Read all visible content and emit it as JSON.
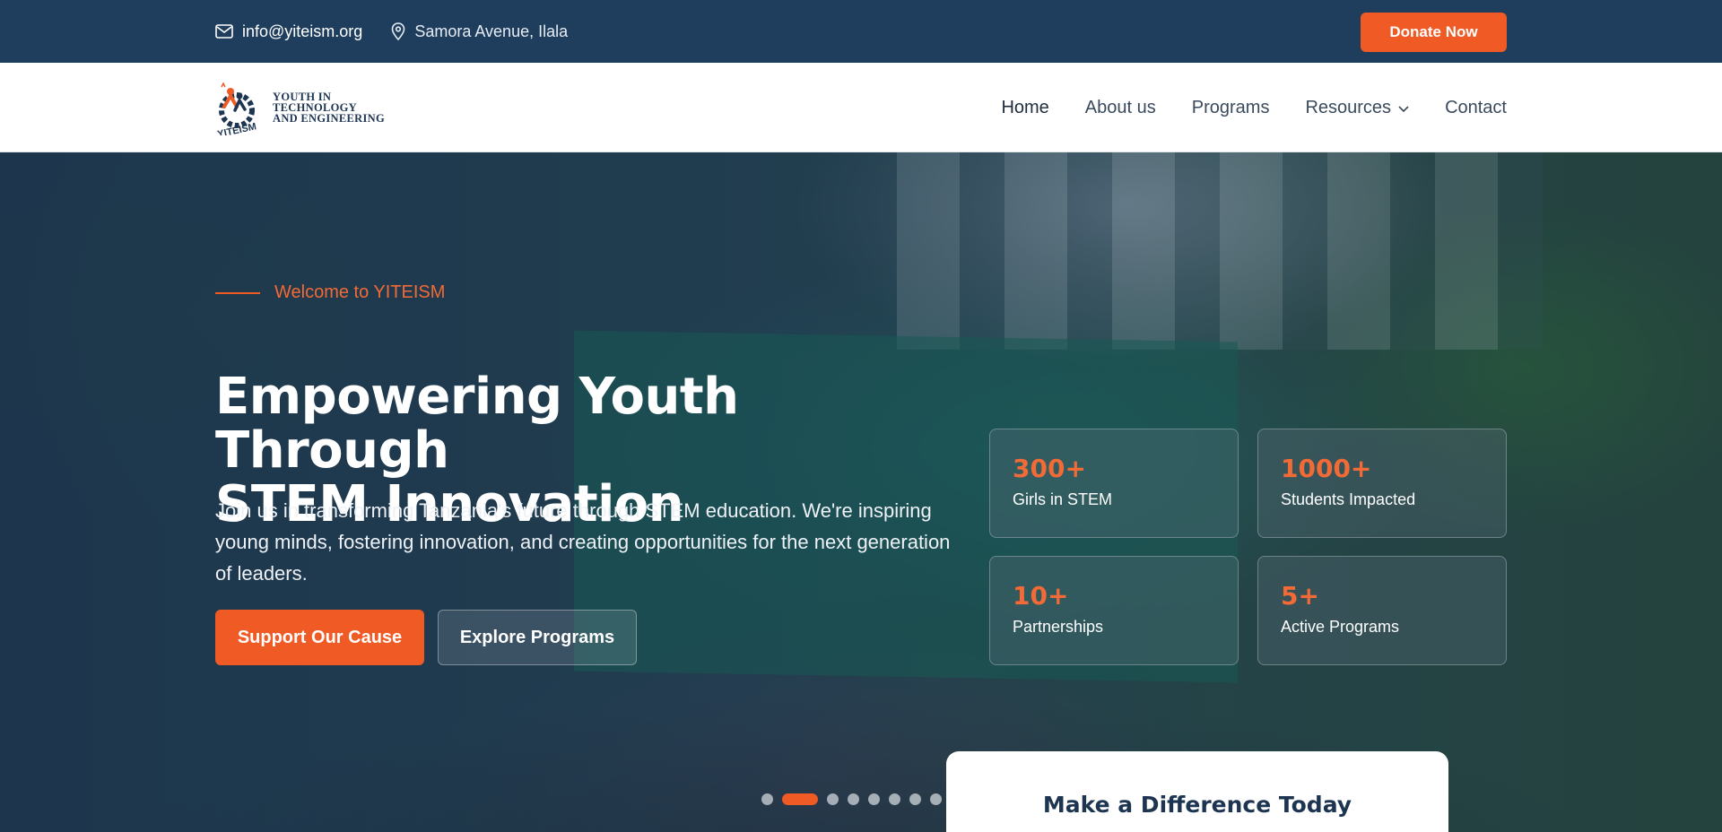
{
  "topbar": {
    "email": "info@yiteism.org",
    "address": "Samora Avenue, Ilala",
    "donate_label": "Donate Now",
    "icons": [
      "mail-icon",
      "map-pin-icon"
    ]
  },
  "logo": {
    "mark_text": "YITEISM",
    "lines": [
      "YOUTH IN",
      "TECHNOLOGY",
      "AND ENGINEERING"
    ]
  },
  "nav": {
    "items": [
      {
        "label": "Home",
        "active": true
      },
      {
        "label": "About us"
      },
      {
        "label": "Programs"
      },
      {
        "label": "Resources",
        "has_dropdown": true
      },
      {
        "label": "Contact"
      }
    ]
  },
  "hero": {
    "eyebrow": "Welcome to YITEISM",
    "headline_line1": "Empowering Youth Through",
    "headline_line2": "STEM Innovation",
    "subtext": "Join us in transforming Tanzania's future through STEM education. We're inspiring young minds, fostering innovation, and creating opportunities for the next generation of leaders.",
    "primary_cta": "Support Our Cause",
    "secondary_cta": "Explore Programs",
    "stats": [
      {
        "value": "300+",
        "label": "Girls in STEM"
      },
      {
        "value": "1000+",
        "label": "Students Impacted"
      },
      {
        "value": "10+",
        "label": "Partnerships"
      },
      {
        "value": "5+",
        "label": "Active Programs"
      }
    ],
    "slider": {
      "count": 9,
      "active_index": 1
    }
  },
  "cta_card": {
    "title": "Make a Difference Today"
  },
  "colors": {
    "accent": "#f05a24",
    "navy": "#1f3e5d",
    "white": "#ffffff"
  }
}
